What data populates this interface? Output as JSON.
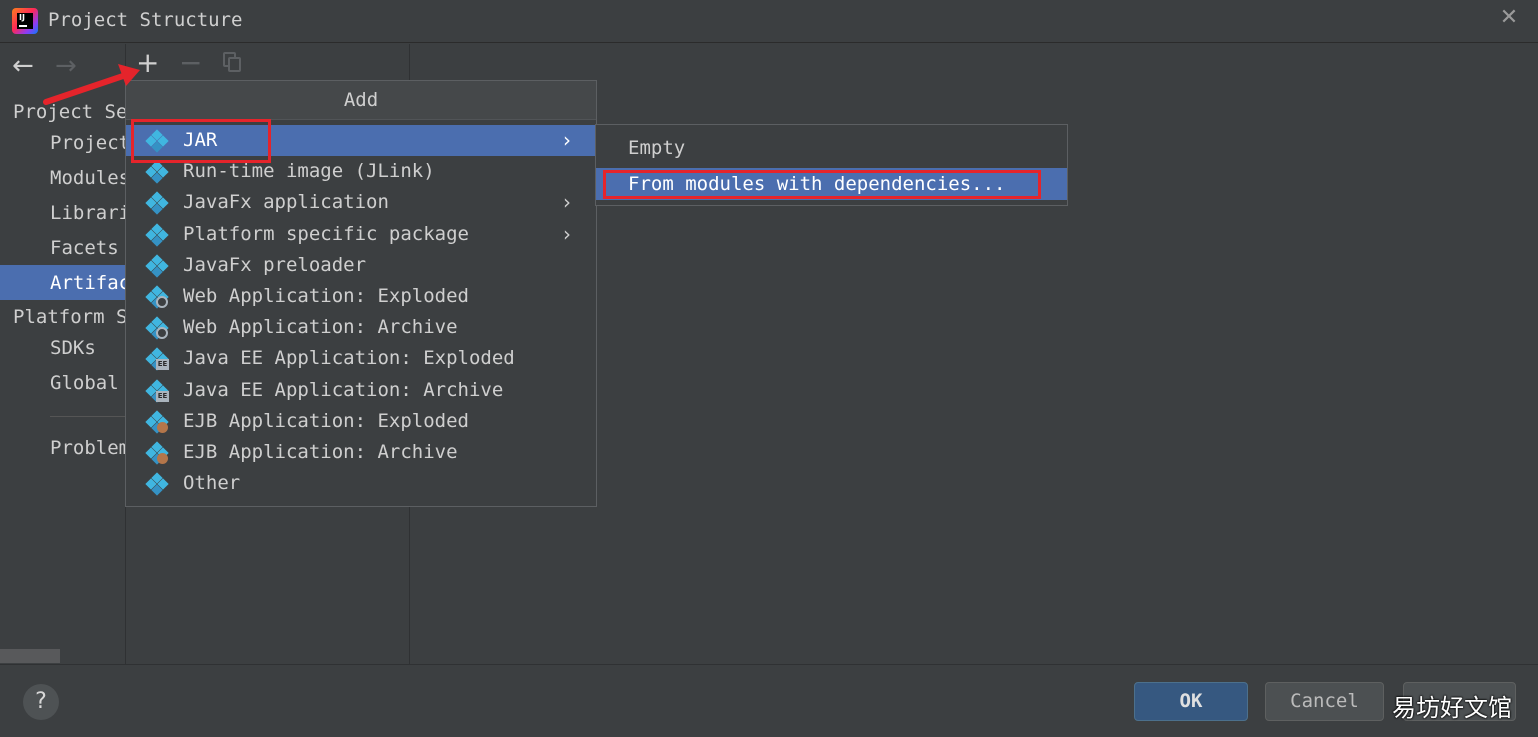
{
  "window": {
    "title": "Project Structure",
    "app_icon": "intellij-idea-icon",
    "close_icon": "close-icon",
    "close_glyph": "✕"
  },
  "nav": {
    "back_glyph": "←",
    "forward_glyph": "→"
  },
  "sidebar": {
    "section_project": "Project Se",
    "items_project": [
      "Project",
      "Modules",
      "Librari",
      "Facets",
      "Artifac"
    ],
    "section_platform": "Platform S",
    "items_platform": [
      "SDKs",
      "Global"
    ],
    "problems": "Problem",
    "selected_item": "Artifac"
  },
  "toolbar": {
    "add_glyph": "+",
    "remove_glyph": "−"
  },
  "popup": {
    "header": "Add",
    "items": [
      {
        "label": "JAR",
        "icon": "artifact-icon",
        "submenu": true
      },
      {
        "label": "Run-time image (JLink)",
        "icon": "artifact-icon",
        "submenu": false
      },
      {
        "label": "JavaFx application",
        "icon": "artifact-icon",
        "submenu": true
      },
      {
        "label": "Platform specific package",
        "icon": "artifact-icon",
        "submenu": true
      },
      {
        "label": "JavaFx preloader",
        "icon": "artifact-icon",
        "submenu": false
      },
      {
        "label": "Web Application: Exploded",
        "icon": "web-artifact-icon",
        "submenu": false
      },
      {
        "label": "Web Application: Archive",
        "icon": "web-artifact-icon",
        "submenu": false
      },
      {
        "label": "Java EE Application: Exploded",
        "icon": "javaee-artifact-icon",
        "submenu": false
      },
      {
        "label": "Java EE Application: Archive",
        "icon": "javaee-artifact-icon",
        "submenu": false
      },
      {
        "label": "EJB Application: Exploded",
        "icon": "ejb-artifact-icon",
        "submenu": false
      },
      {
        "label": "EJB Application: Archive",
        "icon": "ejb-artifact-icon",
        "submenu": false
      },
      {
        "label": "Other",
        "icon": "artifact-icon",
        "submenu": false
      }
    ],
    "chevron_glyph": "›",
    "ee_badge": "EE"
  },
  "submenu": {
    "items": [
      "Empty",
      "From modules with dependencies..."
    ]
  },
  "footer": {
    "help_glyph": "?",
    "ok_label": "OK",
    "cancel_label": "Cancel"
  },
  "watermark": "易坊好文馆",
  "colors": {
    "background": "#3c3f41",
    "selection": "#4b6eaf",
    "highlight": "#e5242b",
    "artifact_icon": "#40b6e0",
    "ok_button": "#365880"
  }
}
